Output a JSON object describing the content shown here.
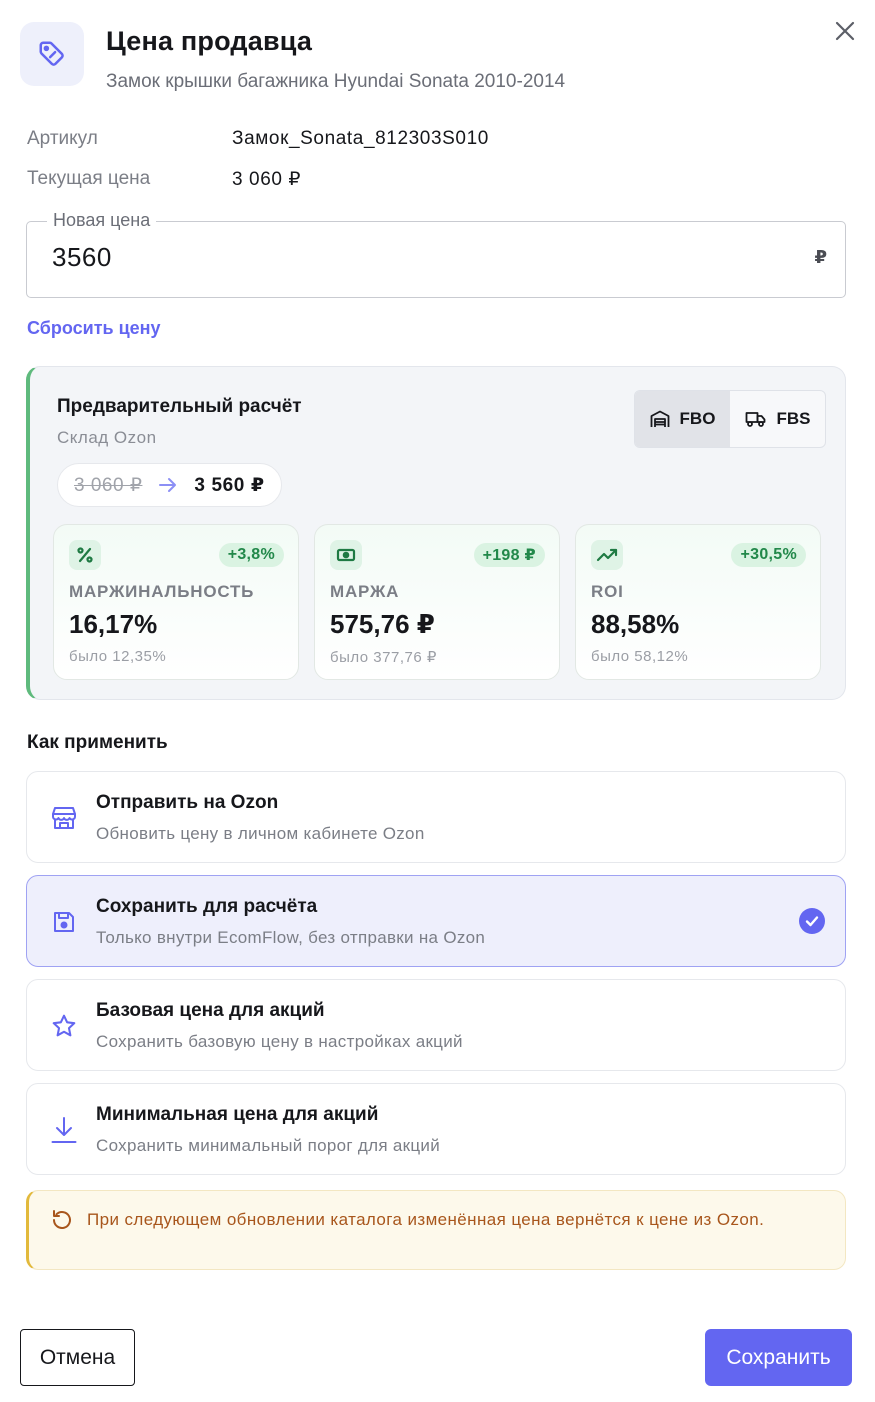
{
  "header": {
    "title": "Цена продавца",
    "subtitle": "Замок крышки багажника Hyundai Sonata 2010-2014",
    "icon": "price-tag-icon",
    "close_icon": "close-icon"
  },
  "info": {
    "article_label": "Артикул",
    "article_value": "Замок_Sonata_812303S010",
    "current_price_label": "Текущая цена",
    "current_price_value": "3 060 ₽"
  },
  "price_input": {
    "label": "Новая цена",
    "value": "3560",
    "currency": "₽"
  },
  "reset_label": "Сбросить цену",
  "calculation": {
    "title": "Предварительный расчёт",
    "subtitle": "Склад Ozon",
    "modes": [
      {
        "label": "FBO",
        "icon": "warehouse-icon",
        "active": true
      },
      {
        "label": "FBS",
        "icon": "truck-icon",
        "active": false
      }
    ],
    "old_price": "3 060 ₽",
    "new_price": "3 560 ₽",
    "metrics": [
      {
        "label": "МАРЖИНАЛЬНОСТЬ",
        "value": "16,17%",
        "delta": "+3,8%",
        "prev": "было 12,35%",
        "icon": "percent-icon"
      },
      {
        "label": "МАРЖА",
        "value": "575,76 ₽",
        "delta": "+198 ₽",
        "prev": "было 377,76 ₽",
        "icon": "banknote-icon"
      },
      {
        "label": "ROI",
        "value": "88,58%",
        "delta": "+30,5%",
        "prev": "было 58,12%",
        "icon": "trending-up-icon"
      }
    ]
  },
  "apply": {
    "heading": "Как применить",
    "options": [
      {
        "title": "Отправить на Ozon",
        "subtitle": "Обновить цену в личном кабинете Ozon",
        "icon": "store-icon",
        "selected": false
      },
      {
        "title": "Сохранить для расчёта",
        "subtitle": "Только внутри EcomFlow, без отправки на Ozon",
        "icon": "save-icon",
        "selected": true
      },
      {
        "title": "Базовая цена для акций",
        "subtitle": "Сохранить базовую цену в настройках акций",
        "icon": "star-icon",
        "selected": false
      },
      {
        "title": "Минимальная цена для акций",
        "subtitle": "Сохранить минимальный порог для акций",
        "icon": "download-icon",
        "selected": false
      }
    ]
  },
  "warning": {
    "text": "При следующем обновлении каталога изменённая цена вернётся к цене из Ozon.",
    "icon": "refresh-icon"
  },
  "footer": {
    "cancel_label": "Отмена",
    "save_label": "Сохранить"
  },
  "colors": {
    "accent": "#6366f1",
    "success": "#22884a",
    "warning_text": "#a8561c",
    "calc_border": "#5fba7d"
  }
}
